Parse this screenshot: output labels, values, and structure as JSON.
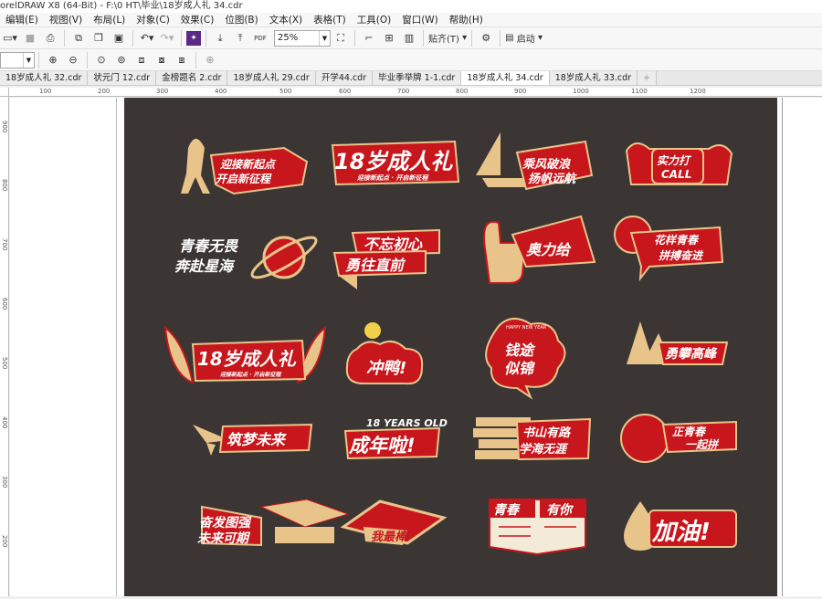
{
  "window": {
    "title": "orelDRAW X8 (64-Bit) - F:\\0 HT\\毕业\\18岁成人礼 34.cdr"
  },
  "menu": [
    "编辑(E)",
    "视图(V)",
    "布局(L)",
    "对象(C)",
    "效果(C)",
    "位图(B)",
    "文本(X)",
    "表格(T)",
    "工具(O)",
    "窗口(W)",
    "帮助(H)"
  ],
  "toolbar": {
    "zoom": "25%",
    "snap_label": "贴齐(T)",
    "launch_label": "启动",
    "pdf_label": "PDF"
  },
  "tabs": [
    "18岁成人礼 32.cdr",
    "状元门 12.cdr",
    "金榜题名 2.cdr",
    "18岁成人礼 29.cdr",
    "开学44.cdr",
    "毕业季举牌 1-1.cdr",
    "18岁成人礼 34.cdr",
    "18岁成人礼 33.cdr"
  ],
  "active_tab_index": 6,
  "ruler": {
    "h_ticks": [
      "100",
      "200",
      "300",
      "400",
      "500",
      "600",
      "700",
      "800",
      "900",
      "1000",
      "1100",
      "1200"
    ],
    "v_ticks": [
      "900",
      "800",
      "700",
      "600",
      "500",
      "400",
      "300",
      "200"
    ]
  },
  "stickers": [
    {
      "lines": [
        "迎接新起点",
        "开启新征程"
      ]
    },
    {
      "lines": [
        "18岁成人礼",
        "迎接新起点 · 开启新征程"
      ]
    },
    {
      "lines": [
        "乘风破浪",
        "扬帆远航"
      ]
    },
    {
      "lines": [
        "实力打",
        "CALL"
      ]
    },
    {
      "lines": [
        "青春无畏",
        "奔赴星海"
      ]
    },
    {
      "lines": [
        "不忘初心",
        "勇往直前"
      ]
    },
    {
      "lines": [
        "奥力给"
      ]
    },
    {
      "lines": [
        "花样青春",
        "拼搏奋进"
      ]
    },
    {
      "lines": [
        "18岁成人礼",
        "迎接新起点 · 开启新征程"
      ]
    },
    {
      "lines": [
        "冲鸭!"
      ]
    },
    {
      "lines": [
        "钱途",
        "似锦",
        "HAPPY NEW YEAR"
      ]
    },
    {
      "lines": [
        "勇攀高峰"
      ]
    },
    {
      "lines": [
        "筑梦未来"
      ]
    },
    {
      "lines": [
        "18 YEARS OLD",
        "成年啦!"
      ]
    },
    {
      "lines": [
        "书山有路",
        "学海无涯"
      ]
    },
    {
      "lines": [
        "正青春",
        "一起拼"
      ]
    },
    {
      "lines": [
        "奋发图强",
        "未来可期"
      ]
    },
    {
      "lines": [
        "我最棒"
      ]
    },
    {
      "lines": [
        "青春",
        "有你"
      ]
    },
    {
      "lines": [
        "加油!"
      ]
    }
  ],
  "colors": {
    "sticker_red": "#c8161d",
    "sticker_gold": "#e8c48a",
    "artboard": "#3b3534"
  }
}
